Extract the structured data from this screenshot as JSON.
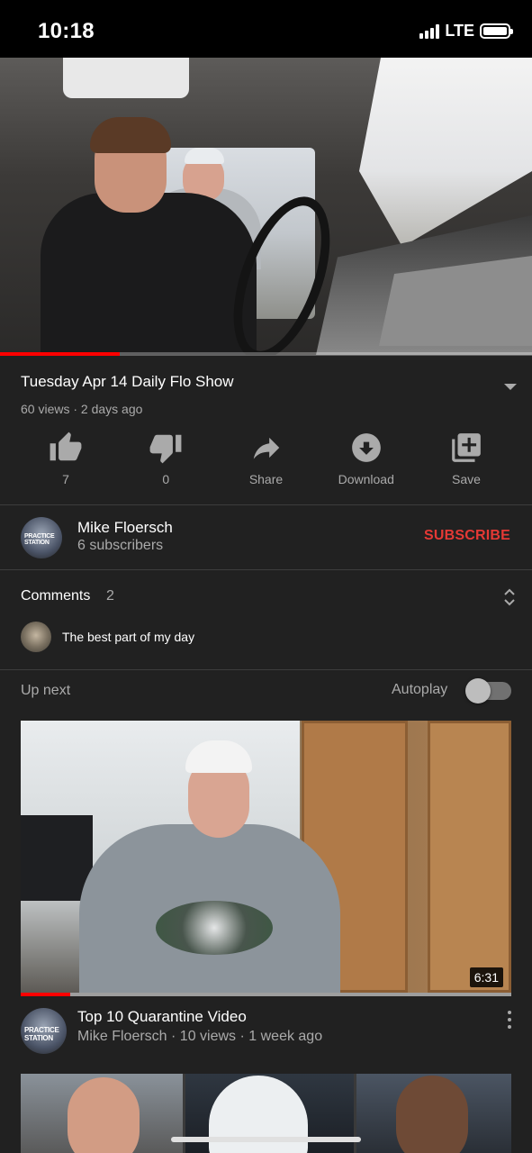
{
  "status_bar": {
    "time": "10:18",
    "network": "LTE",
    "battery_level": 1.0
  },
  "player": {
    "progress": 0.225
  },
  "video": {
    "title": "Tuesday Apr 14 Daily Flo Show",
    "meta": "60 views · 2 days ago"
  },
  "actions": [
    {
      "icon": "thumbs-up-icon",
      "label": "7"
    },
    {
      "icon": "thumbs-down-icon",
      "label": "0"
    },
    {
      "icon": "share-icon",
      "label": "Share"
    },
    {
      "icon": "download-icon",
      "label": "Download"
    },
    {
      "icon": "playlist-add-icon",
      "label": "Save"
    }
  ],
  "channel": {
    "name": "Mike Floersch",
    "subscribers": "6 subscribers",
    "subscribe_label": "SUBSCRIBE",
    "avatar_text": "PRACTICE STATION"
  },
  "comments": {
    "title": "Comments",
    "count": "2",
    "top_comment": "The best part of my day"
  },
  "up_next": {
    "label": "Up next",
    "autoplay_label": "Autoplay",
    "autoplay_on": false,
    "video": {
      "duration": "6:31",
      "watched_progress": 0.1,
      "title": "Top 10 Quarantine Video",
      "meta": "Mike Floersch · 10 views · 1 week ago",
      "channel_avatar_text": "PRACTICE STATION"
    }
  },
  "colors": {
    "accent": "#ff0000",
    "subscribe": "#e53935",
    "background": "#212121"
  }
}
